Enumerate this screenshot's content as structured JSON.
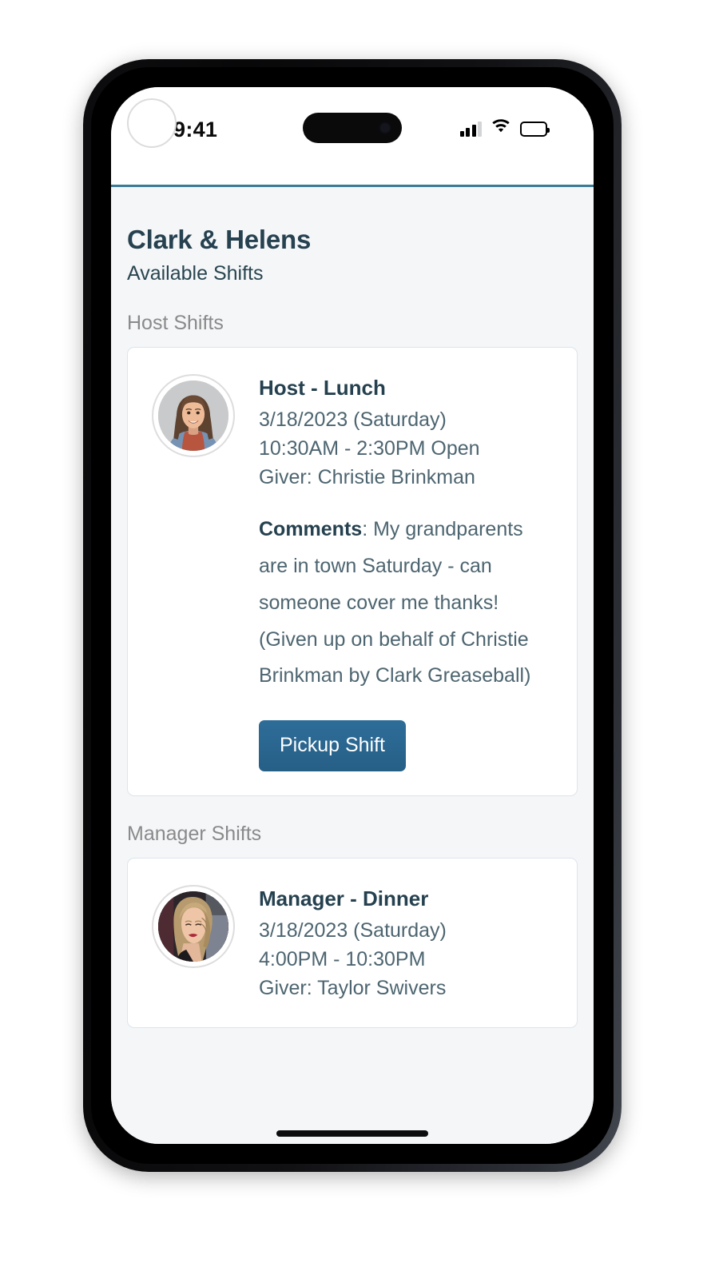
{
  "status_bar": {
    "time": "9:41",
    "signal_icon": "signal-bars-icon",
    "wifi_icon": "wifi-icon",
    "battery_icon": "battery-full-icon"
  },
  "header": {
    "accent_color": "#3b7b97",
    "logo_icon": "avatar-circle-icon"
  },
  "page": {
    "title": "Clark & Helens",
    "subtitle": "Available Shifts",
    "background_color": "#f4f6f8",
    "title_color": "#26414f",
    "section_label_color": "#8a8a8a"
  },
  "sections": [
    {
      "label": "Host Shifts",
      "shifts": [
        {
          "avatar": "christie-brinkman-avatar",
          "title": "Host - Lunch",
          "date": "3/18/2023 (Saturday)",
          "time": "10:30AM - 2:30PM  Open",
          "giver": "Giver: Christie Brinkman",
          "comments_label": "Comments",
          "comments_text": ": My grandparents are in town Saturday - can someone cover me thanks! (Given up on behalf of Christie Brinkman by Clark Greaseball)",
          "action_label": "Pickup Shift",
          "action_color": "#26648a"
        }
      ]
    },
    {
      "label": "Manager Shifts",
      "shifts": [
        {
          "avatar": "taylor-swivers-avatar",
          "title": "Manager - Dinner",
          "date": "3/18/2023 (Saturday)",
          "time": "4:00PM - 10:30PM",
          "giver": "Giver: Taylor Swivers"
        }
      ]
    }
  ]
}
